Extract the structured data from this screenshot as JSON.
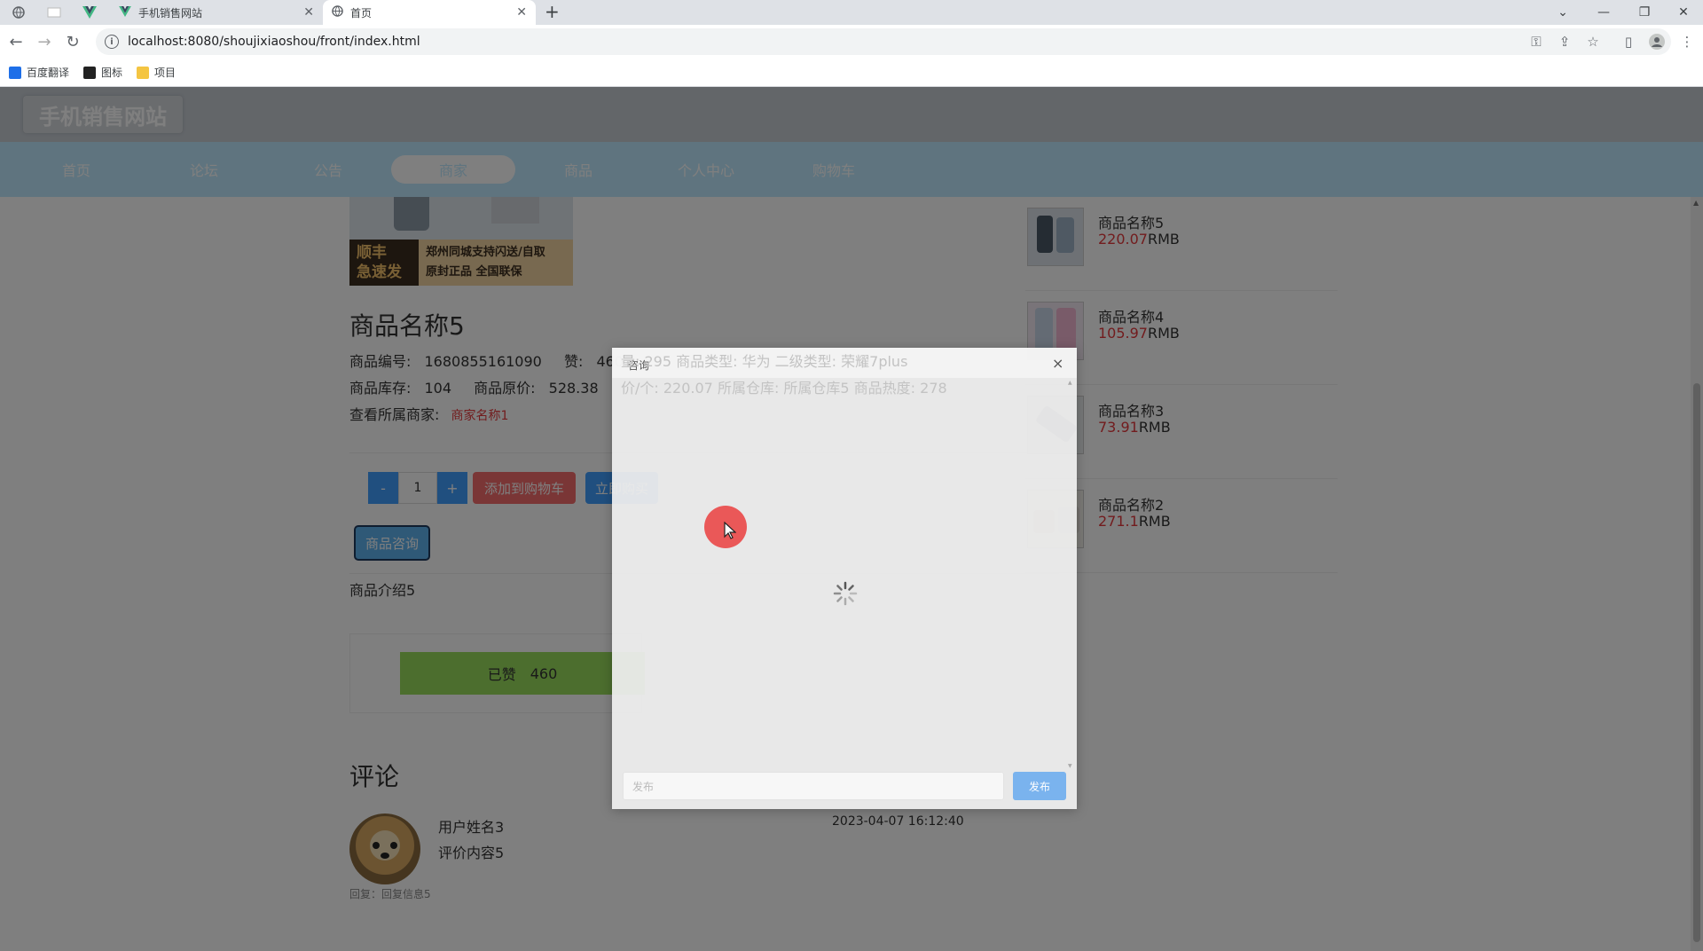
{
  "browser": {
    "tabs": [
      {
        "title": "手机销售网站",
        "active": false
      },
      {
        "title": "首页",
        "active": true
      }
    ],
    "url": "localhost:8080/shoujixiaoshou/front/index.html",
    "bookmarks": [
      {
        "label": "百度翻译",
        "icon": "translate-icon",
        "color": "#1e6fe8"
      },
      {
        "label": "图标",
        "icon": "image-icon",
        "color": "#222222"
      },
      {
        "label": "项目",
        "icon": "folder-icon",
        "color": "#f4c542"
      }
    ]
  },
  "site": {
    "logo": "手机销售网站",
    "nav": [
      {
        "label": "首页",
        "active": false
      },
      {
        "label": "论坛",
        "active": false
      },
      {
        "label": "公告",
        "active": false
      },
      {
        "label": "商家",
        "active": true
      },
      {
        "label": "商品",
        "active": false
      },
      {
        "label": "个人中心",
        "active": false
      },
      {
        "label": "购物车",
        "active": false
      }
    ]
  },
  "product": {
    "image_text_left": "顺丰\n急速发",
    "image_text_right_1": "郑州同城支持闪送/自取",
    "image_text_right_2": "原封正品 全国联保",
    "title": "商品名称5",
    "code_label": "商品编号:",
    "code": "1680855161090",
    "likes_label": "赞:",
    "likes": "460",
    "stock_label": "商品库存:",
    "stock": "104",
    "orig_price_label": "商品原价:",
    "orig_price": "528.38",
    "merchant_label": "查看所属商家:",
    "merchant": "商家名称1",
    "quantity": "1",
    "minus": "-",
    "plus": "+",
    "add_cart": "添加到购物车",
    "buy_now": "立即购买",
    "consult": "商品咨询",
    "description": "商品介绍5",
    "liked_label": "已赞",
    "liked_count": "460"
  },
  "comments": {
    "title": "评论",
    "items": [
      {
        "user": "用户姓名3",
        "text": "评价内容5",
        "time": "2023-04-07 16:12:40",
        "reply": "回复：回复信息5"
      }
    ]
  },
  "recommend": [
    {
      "name": "商品名称5",
      "price": "220.07",
      "unit": "RMB"
    },
    {
      "name": "商品名称4",
      "price": "105.97",
      "unit": "RMB"
    },
    {
      "name": "商品名称3",
      "price": "73.91",
      "unit": "RMB"
    },
    {
      "name": "商品名称2",
      "price": "271.1",
      "unit": "RMB"
    }
  ],
  "dialog": {
    "title": "咨询",
    "close": "×",
    "ghost_line1": "量: 295    商品类型:   华为    二级类型:   荣耀7plus",
    "ghost_line2": "价/个:   220.07    所属仓库:   所属仓库5    商品热度:   278",
    "input_placeholder": "发布",
    "send": "发布"
  },
  "colors": {
    "nav_bg": "#bfe9ff",
    "header_bg": "#c6ccd3",
    "primary": "#409eff",
    "danger": "#f56c6c",
    "liked": "#98dd5d",
    "price": "#e4393c"
  }
}
